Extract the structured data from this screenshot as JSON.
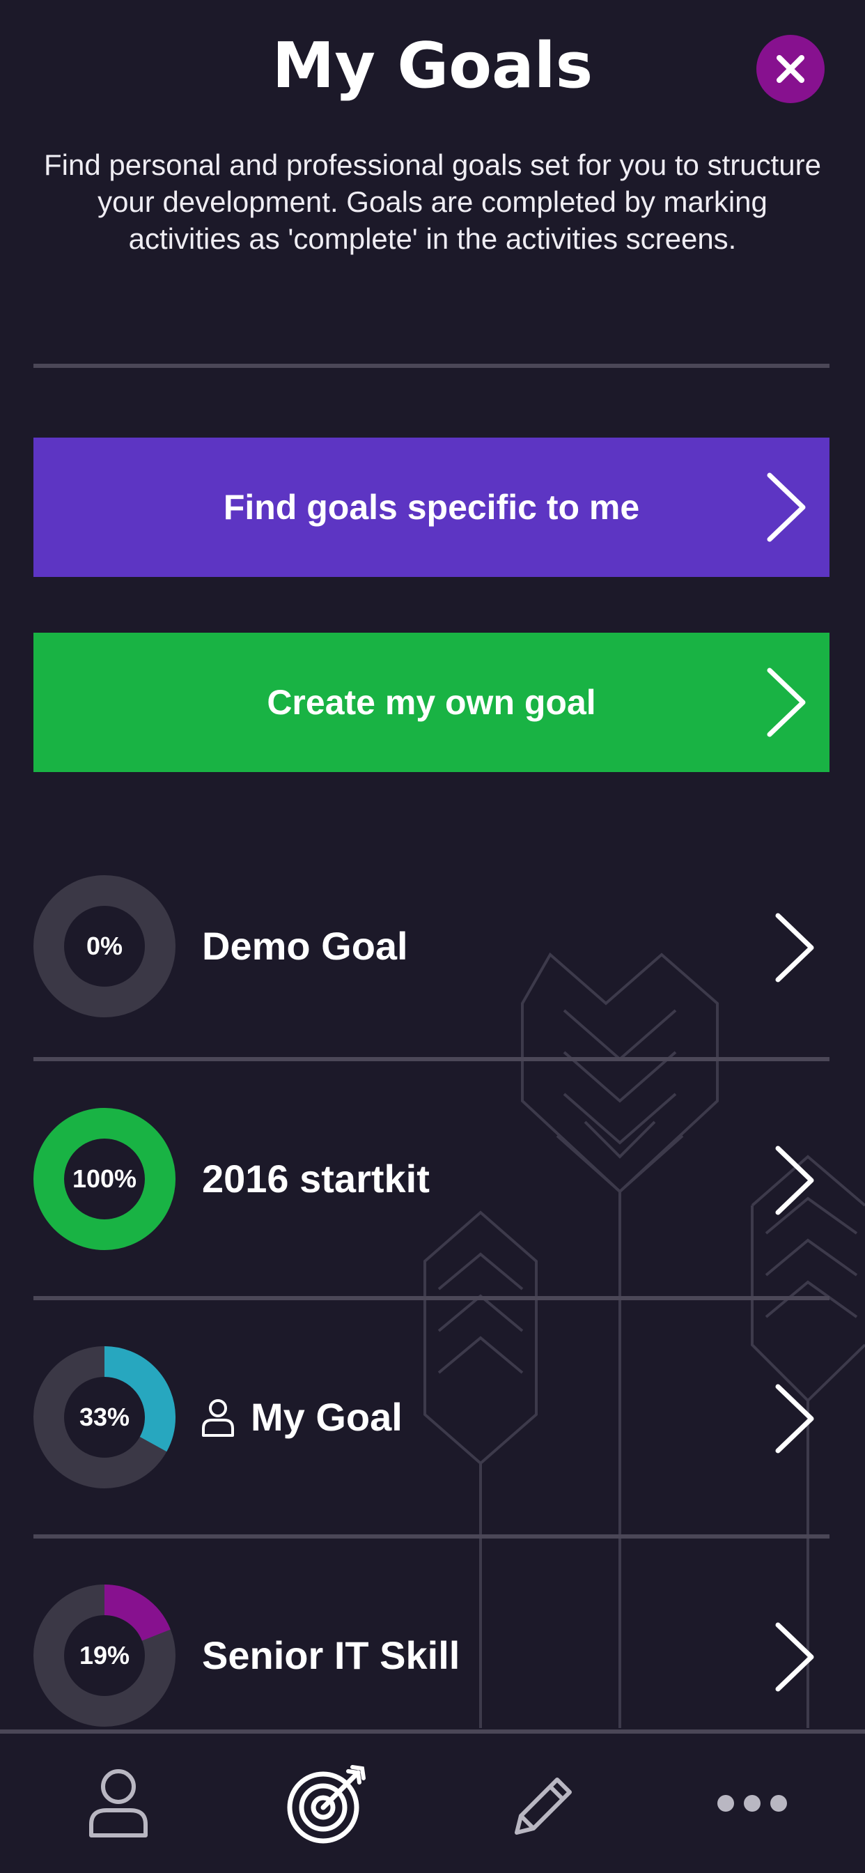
{
  "header": {
    "title": "My Goals",
    "description": "Find personal and professional goals set for you to structure your development. Goals are completed by marking activities as 'complete' in the activities screens."
  },
  "actions": {
    "find_goals_label": "Find goals specific to me",
    "create_goal_label": "Create my own goal"
  },
  "goals": [
    {
      "name": "Demo Goal",
      "progress_label": "0%",
      "progress": 0,
      "color": "#3b3846",
      "personal": false
    },
    {
      "name": "2016 startkit",
      "progress_label": "100%",
      "progress": 100,
      "color": "#19b344",
      "personal": false
    },
    {
      "name": "My Goal",
      "progress_label": "33%",
      "progress": 33,
      "color": "#27a7bf",
      "personal": true
    },
    {
      "name": "Senior IT Skill",
      "progress_label": "19%",
      "progress": 19,
      "color": "#87118f",
      "personal": false
    }
  ],
  "nav": {
    "items": [
      "profile-icon",
      "target-icon",
      "pencil-icon",
      "more-icon"
    ]
  },
  "colors": {
    "background": "#1c1929",
    "divider": "#4b4757",
    "purple": "#5d35c3",
    "green": "#19b344",
    "close": "#87118f",
    "ring_track": "#3b3846"
  }
}
